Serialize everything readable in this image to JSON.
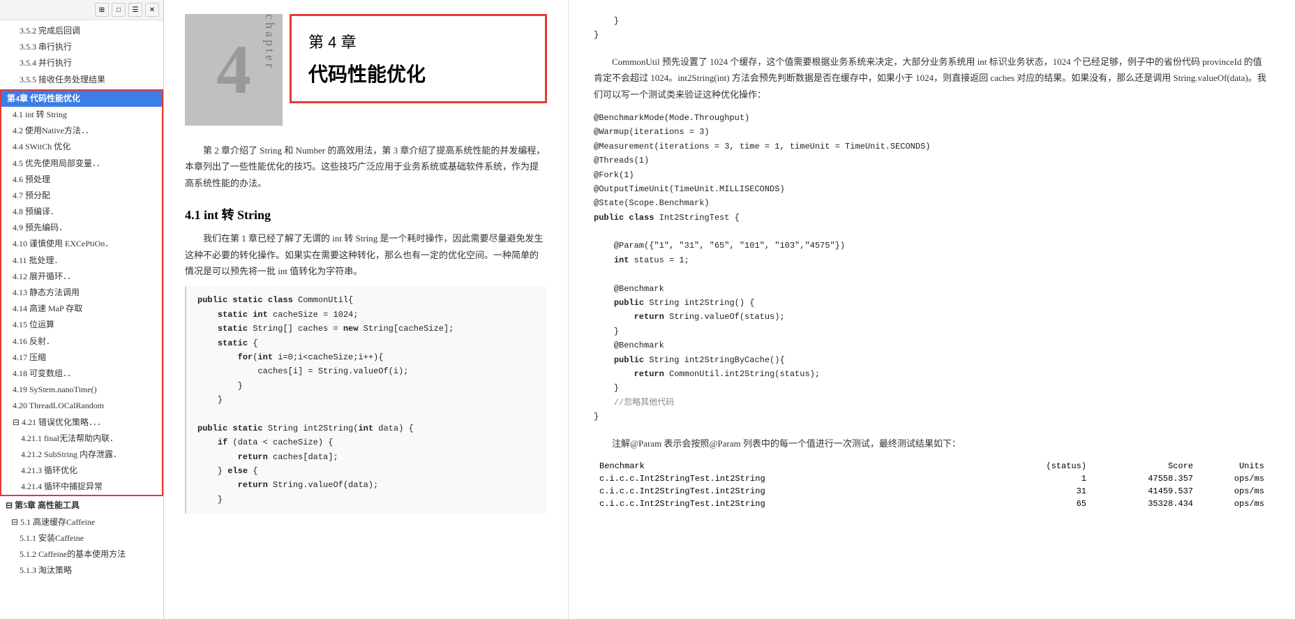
{
  "sidebar": {
    "toolbar": {
      "btn1": "⊞",
      "btn2": "□",
      "btn3": "☰",
      "btn4": "✕"
    },
    "toc": [
      {
        "id": "3-5-2",
        "level": "subsection",
        "text": "3.5.2 完成后回调",
        "selected": false
      },
      {
        "id": "3-5-3",
        "level": "subsection",
        "text": "3.5.3 串行执行",
        "selected": false
      },
      {
        "id": "3-5-4",
        "level": "subsection",
        "text": "3.5.4 并行执行",
        "selected": false
      },
      {
        "id": "3-5-5",
        "level": "subsection",
        "text": "3.5.5 接收任务处理结果",
        "selected": false
      },
      {
        "id": "ch4",
        "level": "chapter highlighted selected",
        "text": "第4章 代码性能优化",
        "selected": true
      },
      {
        "id": "4-1",
        "level": "section highlighted",
        "text": "4.1 int 转 String",
        "selected": false
      },
      {
        "id": "4-2",
        "level": "section highlighted",
        "text": "4.2 使用Native方法．．",
        "selected": false
      },
      {
        "id": "4-4",
        "level": "section highlighted",
        "text": "4.4 SWitCh 优化",
        "selected": false
      },
      {
        "id": "4-5",
        "level": "section highlighted",
        "text": "4.5 优先使用局部变量．．",
        "selected": false
      },
      {
        "id": "4-6",
        "level": "section highlighted",
        "text": "4.6 预处理",
        "selected": false
      },
      {
        "id": "4-7",
        "level": "section highlighted",
        "text": "4.7 预分配",
        "selected": false
      },
      {
        "id": "4-8",
        "level": "section highlighted",
        "text": "4.8 预编译．",
        "selected": false
      },
      {
        "id": "4-9",
        "level": "section highlighted",
        "text": "4.9 预先编码．",
        "selected": false
      },
      {
        "id": "4-10",
        "level": "section highlighted",
        "text": "4.10 谨慎使用 EXCePtiOn．",
        "selected": false
      },
      {
        "id": "4-11",
        "level": "section highlighted",
        "text": "4.11 批处理．",
        "selected": false
      },
      {
        "id": "4-12",
        "level": "section highlighted",
        "text": "4.12 展开循环．．",
        "selected": false
      },
      {
        "id": "4-13",
        "level": "section highlighted",
        "text": "4.13 静态方法调用",
        "selected": false
      },
      {
        "id": "4-14",
        "level": "section highlighted",
        "text": "4.14 高速 MaP 存取",
        "selected": false
      },
      {
        "id": "4-15",
        "level": "section highlighted",
        "text": "4.15 位运算",
        "selected": false
      },
      {
        "id": "4-16",
        "level": "section highlighted",
        "text": "4.16 反射．",
        "selected": false
      },
      {
        "id": "4-17",
        "level": "section highlighted",
        "text": "4.17 压缩",
        "selected": false
      },
      {
        "id": "4-18",
        "level": "section highlighted",
        "text": "4.18 可变数组．．",
        "selected": false
      },
      {
        "id": "4-19",
        "level": "section highlighted",
        "text": "4.19 SyStem.nanoTime()",
        "selected": false
      },
      {
        "id": "4-20",
        "level": "section highlighted",
        "text": "4.20 ThreadLOCalRandom",
        "selected": false
      },
      {
        "id": "4-21",
        "level": "section highlighted",
        "text": "⊟ 4.21 错误优化策略．．．",
        "selected": false
      },
      {
        "id": "4-21-1",
        "level": "subsection highlighted",
        "text": "4.21.1 final无法帮助内联．",
        "selected": false
      },
      {
        "id": "4-21-2",
        "level": "subsection highlighted",
        "text": "4.21.2 SubString 内存泄露．",
        "selected": false
      },
      {
        "id": "4-21-3",
        "level": "subsection highlighted",
        "text": "4.21.3 循环优化",
        "selected": false
      },
      {
        "id": "4-21-4",
        "level": "subsection highlighted",
        "text": "4.21.4 循环中捕捉异常",
        "selected": false
      },
      {
        "id": "ch5",
        "level": "chapter",
        "text": "⊟ 第5章 高性能工具",
        "selected": false
      },
      {
        "id": "5-1",
        "level": "section",
        "text": "⊟ 5.1 高速缓存Caffeine",
        "selected": false
      },
      {
        "id": "5-1-1",
        "level": "subsection",
        "text": "5.1.1 安装Caffeine",
        "selected": false
      },
      {
        "id": "5-1-2",
        "level": "subsection",
        "text": "5.1.2 Caffeine的基本使用方法",
        "selected": false
      },
      {
        "id": "5-1-3",
        "level": "subsection",
        "text": "5.1.3 淘汰策略",
        "selected": false
      }
    ]
  },
  "chapter": {
    "number": "4",
    "label": "第 4 章",
    "title": "代码性能优化",
    "chapter_word": "chapter",
    "intro": "第 2 章介绍了 String 和 Number 的高效用法，第 3 章介绍了提高系统性能的并发编程，本章列出了一些性能优化的技巧。这些技巧广泛应用于业务系统或基础软件系统，作为提高系统性能的办法。"
  },
  "section41": {
    "heading": "4.1  int 转 String",
    "para1": "我们在第 1 章已经了解了无谓的 int 转 String 是一个耗时操作，因此需要尽量避免发生这种不必要的转化操作。如果实在需要这种转化，那么也有一定的优化空间。一种简单的情况是可以预先将一批 int 值转化为字符串。",
    "code1": "public static class CommonUtil{\n    static int cacheSize = 1024;\n    static String[] caches = new String[cacheSize];\n    static {\n        for(int i=0;i<cacheSize;i++){\n            caches[i] = String.valueOf(i);\n        }\n    }\n\npublic static String int2String(int data) {\n    if (data < cacheSize) {\n        return caches[data];\n    } else {\n        return String.valueOf(data);\n    }"
  },
  "right_page": {
    "code_top": "    }\n}",
    "para1": "CommonUtil 预先设置了 1024 个缓存，这个值需要根据业务系统来决定，大部分业务系统用 int 标识业务状态，1024 个已经足够，例子中的省份代码 provinceId 的值肯定不会超过 1024。int2String(int) 方法会预先判断数据是否在缓存中，如果小于 1024，则直接返回 caches 对应的结果。如果没有，那么还是调用 String.valueOf(data)。我们可以写一个测试类来验证这种优化操作：",
    "code2": "@BenchmarkMode(Mode.Throughput)\n@Warmup(iterations = 3)\n@Measurement(iterations = 3, time = 1, timeUnit = TimeUnit.SECONDS)\n@Threads(1)\n@Fork(1)\n@OutputTimeUnit(TimeUnit.MILLISECONDS)\n@State(Scope.Benchmark)\npublic class Int2StringTest {\n\n    @Param({\"1\", \"31\", \"65\", \"101\", \"103\",\"4575\"})\n    int status = 1;\n\n    @Benchmark\n    public String int2String() {\n        return String.valueOf(status);\n    }\n    @Benchmark\n    public String int2StringByCache(){\n        return CommonUtil.int2String(status);\n    }\n    //忽略其他代码\n}",
    "para2": "注解@Param 表示会按照@Param 列表中的每一个值进行一次测试，最终测试结果如下：",
    "benchmark": {
      "header": [
        "Benchmark",
        "(status)",
        "Score",
        "Units"
      ],
      "rows": [
        [
          "c.i.c.c.Int2StringTest.int2String",
          "1",
          "47558.357",
          "ops/ms"
        ],
        [
          "c.i.c.c.Int2StringTest.int2String",
          "31",
          "41459.537",
          "ops/ms"
        ],
        [
          "c.i.c.c.Int2StringTest.int2String",
          "65",
          "35328.434",
          "ops/ms"
        ]
      ]
    }
  }
}
